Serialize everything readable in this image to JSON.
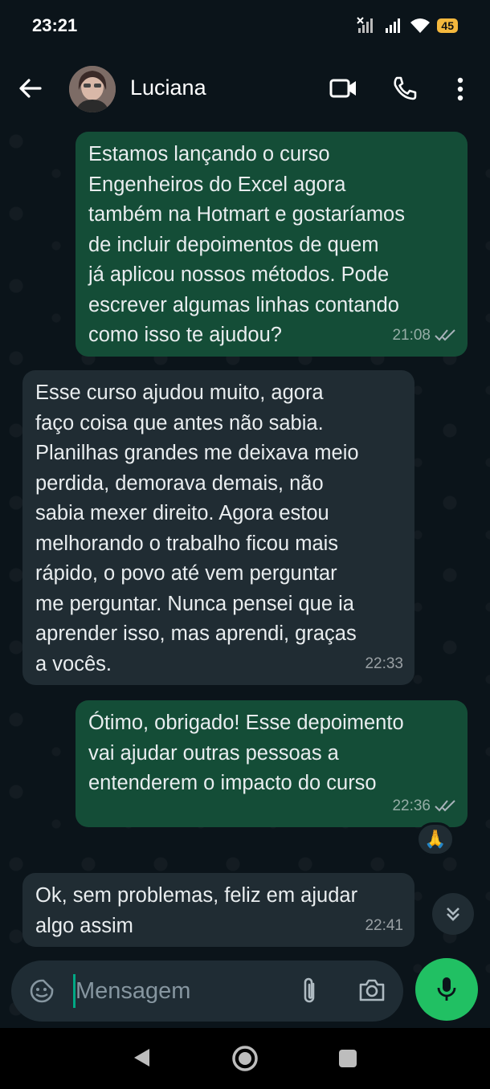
{
  "status_bar": {
    "time": "23:21",
    "battery": "45"
  },
  "header": {
    "contact_name": "Luciana"
  },
  "messages": [
    {
      "direction": "out",
      "text": "Estamos lançando o curso\nEngenheiros do Excel agora\ntambém na Hotmart e gostaríamos\nde incluir depoimentos de quem\njá aplicou nossos métodos. Pode\nescrever algumas linhas contando\ncomo isso te ajudou?",
      "time": "21:08"
    },
    {
      "direction": "in",
      "text": "Esse curso ajudou muito, agora\nfaço coisa que antes não sabia.\nPlanilhas grandes me deixava meio\nperdida, demorava demais, não\nsabia mexer direito. Agora estou\nmelhorando o trabalho ficou mais\nrápido, o povo até vem perguntar\nme perguntar. Nunca pensei que ia\naprender isso, mas aprendi, graças\na vocês.",
      "time": "22:33"
    },
    {
      "direction": "out",
      "text": "Ótimo, obrigado! Esse depoimento\nvai ajudar outras pessoas a\nentenderem o impacto do curso",
      "time": "22:36",
      "reaction": "🙏"
    },
    {
      "direction": "in",
      "text": "Ok, sem problemas, feliz em ajudar\nalgo assim",
      "time": "22:41"
    }
  ],
  "composer": {
    "placeholder": "Mensagem"
  },
  "icons": {
    "read_ticks_color": "#8696a0",
    "accent": "#21c063",
    "outgoing_bubble": "#144d37",
    "incoming_bubble": "#202c33"
  }
}
